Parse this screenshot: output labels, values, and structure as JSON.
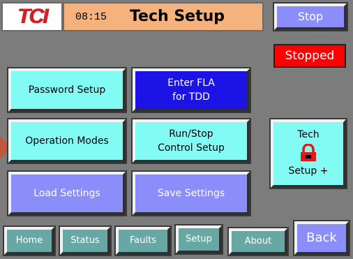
{
  "header": {
    "logo_text": "TCI",
    "time": "08:15",
    "title": "Tech Setup",
    "stop_label": "Stop"
  },
  "status": {
    "label": "Stopped",
    "color": "#ff0000"
  },
  "menu": {
    "password_setup": "Password Setup",
    "enter_fla_line1": "Enter FLA",
    "enter_fla_line2": "for TDD",
    "operation_modes": "Operation Modes",
    "run_stop_line1": "Run/Stop",
    "run_stop_line2": "Control Setup",
    "load_settings": "Load Settings",
    "save_settings": "Save Settings"
  },
  "tech_setup_plus": {
    "line1": "Tech",
    "icon": "padlock-icon",
    "line2": "Setup +"
  },
  "nav": {
    "home": "Home",
    "status": "Status",
    "faults": "Faults",
    "setup": "Setup",
    "about": "About",
    "back": "Back"
  },
  "colors": {
    "background": "#7c7c7c",
    "title_bar": "#f6b27c",
    "cyan_button": "#82fbf5",
    "blue_button": "#1c14e6",
    "lavender_button": "#8b8dfa",
    "teal_nav": "#68a8a4",
    "logo_red": "#d41f26"
  }
}
